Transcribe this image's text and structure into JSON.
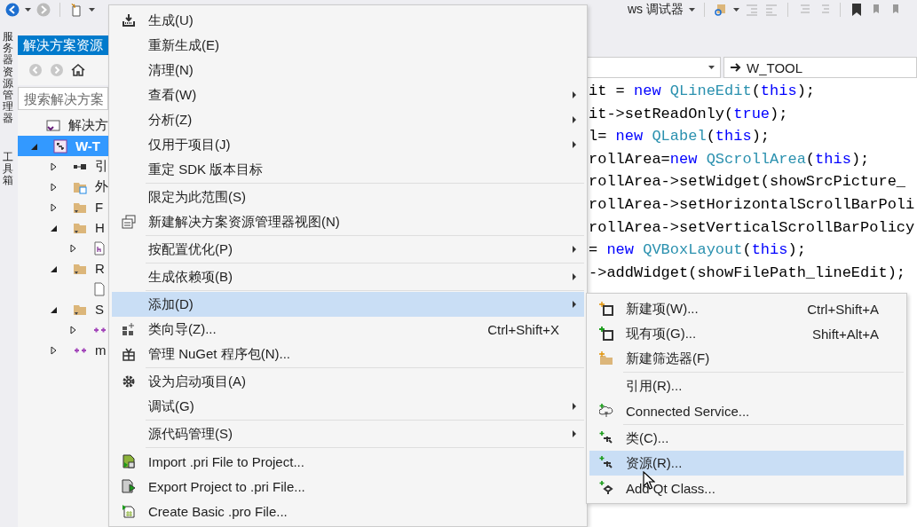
{
  "toolbar": {
    "debugger_label": "ws 调试器"
  },
  "side_tabs": [
    "服务器资源管理器",
    "工具箱"
  ],
  "solution_explorer": {
    "title": "解决方案资源",
    "search": {
      "placeholder": "搜索解决方案"
    },
    "tree": [
      {
        "kind": "solution",
        "label": "解决方",
        "selected": false,
        "children": [
          {
            "kind": "project",
            "label": "W-T",
            "selected": true,
            "expanded": true,
            "children": [
              {
                "kind": "references",
                "label": "引",
                "selected": false,
                "expanded": false
              },
              {
                "kind": "external",
                "label": "外",
                "selected": false,
                "expanded": false
              },
              {
                "kind": "filter",
                "label": "F",
                "selected": false,
                "expanded": false
              },
              {
                "kind": "filter",
                "label": "H",
                "selected": false,
                "expanded": true,
                "children": [
                  {
                    "kind": "header",
                    "selected": false,
                    "expanded": false
                  }
                ]
              },
              {
                "kind": "filter",
                "label": "R",
                "selected": false,
                "expanded": true,
                "children": [
                  {
                    "kind": "file",
                    "selected": false
                  }
                ]
              },
              {
                "kind": "filter",
                "label": "S",
                "selected": false,
                "expanded": true,
                "children": [
                  {
                    "kind": "cpp",
                    "selected": false,
                    "expanded": false
                  }
                ]
              },
              {
                "kind": "cpp",
                "label": "m",
                "selected": false,
                "expanded": false
              }
            ]
          }
        ]
      }
    ]
  },
  "editor": {
    "member_dropdown": "W_TOOL",
    "code_lines": [
      [
        {
          "kind": "plain",
          "text": "it = "
        },
        {
          "kind": "keyword",
          "text": "new"
        },
        {
          "kind": "type",
          "text": " QLineEdit"
        },
        {
          "kind": "plain",
          "text": "("
        },
        {
          "kind": "keyword",
          "text": "this"
        },
        {
          "kind": "plain",
          "text": ");"
        }
      ],
      [
        {
          "kind": "plain",
          "text": "it->setReadOnly("
        },
        {
          "kind": "keyword",
          "text": "true"
        },
        {
          "kind": "plain",
          "text": ");"
        }
      ],
      [
        {
          "kind": "plain",
          "text": "l= "
        },
        {
          "kind": "keyword",
          "text": "new"
        },
        {
          "kind": "type",
          "text": " QLabel"
        },
        {
          "kind": "plain",
          "text": "("
        },
        {
          "kind": "keyword",
          "text": "this"
        },
        {
          "kind": "plain",
          "text": ");"
        }
      ],
      [
        {
          "kind": "plain",
          "text": "rollArea="
        },
        {
          "kind": "keyword",
          "text": "new"
        },
        {
          "kind": "type",
          "text": " QScrollArea"
        },
        {
          "kind": "plain",
          "text": "("
        },
        {
          "kind": "keyword",
          "text": "this"
        },
        {
          "kind": "plain",
          "text": ");"
        }
      ],
      [
        {
          "kind": "plain",
          "text": "rollArea->setWidget(showSrcPicture_"
        }
      ],
      [
        {
          "kind": "plain",
          "text": "rollArea->setHorizontalScrollBarPoli"
        }
      ],
      [
        {
          "kind": "plain",
          "text": "rollArea->setVerticalScrollBarPolicy"
        }
      ],
      [
        {
          "kind": "plain",
          "text": "= "
        },
        {
          "kind": "keyword",
          "text": "new"
        },
        {
          "kind": "type",
          "text": " QVBoxLayout"
        },
        {
          "kind": "plain",
          "text": "("
        },
        {
          "kind": "keyword",
          "text": "this"
        },
        {
          "kind": "plain",
          "text": ");"
        }
      ],
      [
        {
          "kind": "plain",
          "text": "->addWidget(showFilePath_lineEdit);"
        }
      ]
    ]
  },
  "context_menu": {
    "items": [
      {
        "kind": "command",
        "label": "生成(U)",
        "submenu": false,
        "selected": false
      },
      {
        "kind": "command",
        "label": "重新生成(E)",
        "submenu": false,
        "selected": false
      },
      {
        "kind": "command",
        "label": "清理(N)",
        "submenu": false,
        "selected": false
      },
      {
        "kind": "command",
        "label": "查看(W)",
        "submenu": true,
        "selected": false
      },
      {
        "kind": "command",
        "label": "分析(Z)",
        "submenu": true,
        "selected": false
      },
      {
        "kind": "command",
        "label": "仅用于项目(J)",
        "submenu": true,
        "selected": false
      },
      {
        "kind": "command",
        "label": "重定 SDK 版本目标",
        "submenu": false,
        "selected": false
      },
      {
        "kind": "separator"
      },
      {
        "kind": "command",
        "label": "限定为此范围(S)",
        "submenu": false,
        "selected": false
      },
      {
        "kind": "command",
        "label": "新建解决方案资源管理器视图(N)",
        "submenu": false,
        "selected": false
      },
      {
        "kind": "separator"
      },
      {
        "kind": "command",
        "label": "按配置优化(P)",
        "submenu": true,
        "selected": false
      },
      {
        "kind": "separator"
      },
      {
        "kind": "command",
        "label": "生成依赖项(B)",
        "submenu": true,
        "selected": false
      },
      {
        "kind": "separator"
      },
      {
        "kind": "command",
        "label": "添加(D)",
        "submenu": true,
        "selected": true
      },
      {
        "kind": "command",
        "label": "类向导(Z)...",
        "shortcut": "Ctrl+Shift+X",
        "submenu": false,
        "selected": false
      },
      {
        "kind": "command",
        "label": "管理 NuGet 程序包(N)...",
        "submenu": false,
        "selected": false
      },
      {
        "kind": "separator"
      },
      {
        "kind": "command",
        "label": "设为启动项目(A)",
        "submenu": false,
        "selected": false
      },
      {
        "kind": "command",
        "label": "调试(G)",
        "submenu": true,
        "selected": false
      },
      {
        "kind": "separator"
      },
      {
        "kind": "command",
        "label": "源代码管理(S)",
        "submenu": true,
        "selected": false
      },
      {
        "kind": "separator"
      },
      {
        "kind": "command",
        "label": "Import .pri File to Project...",
        "submenu": false,
        "selected": false
      },
      {
        "kind": "command",
        "label": "Export Project to .pri File...",
        "submenu": false,
        "selected": false
      },
      {
        "kind": "command",
        "label": "Create Basic .pro File...",
        "submenu": false,
        "selected": false
      }
    ]
  },
  "add_submenu": {
    "items": [
      {
        "kind": "command",
        "label": "新建项(W)...",
        "shortcut": "Ctrl+Shift+A",
        "submenu": false,
        "selected": false
      },
      {
        "kind": "command",
        "label": "现有项(G)...",
        "shortcut": "Shift+Alt+A",
        "submenu": false,
        "selected": false
      },
      {
        "kind": "command",
        "label": "新建筛选器(F)",
        "submenu": false,
        "selected": false
      },
      {
        "kind": "separator"
      },
      {
        "kind": "command",
        "label": "引用(R)...",
        "submenu": false,
        "selected": false
      },
      {
        "kind": "command",
        "label": "Connected Service...",
        "submenu": false,
        "selected": false
      },
      {
        "kind": "separator"
      },
      {
        "kind": "command",
        "label": "类(C)...",
        "submenu": false,
        "selected": false
      },
      {
        "kind": "command",
        "label": "资源(R)...",
        "submenu": false,
        "selected": true
      },
      {
        "kind": "command",
        "label": "Add Qt Class...",
        "submenu": false,
        "selected": false
      }
    ]
  }
}
